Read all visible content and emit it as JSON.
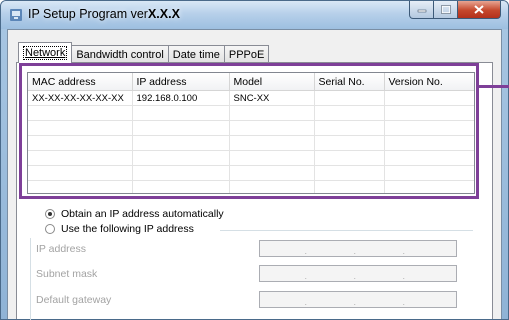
{
  "window": {
    "title_prefix": "IP Setup Program ver",
    "title_version": "X.X.X"
  },
  "tabs": [
    {
      "label": "Network",
      "active": true
    },
    {
      "label": "Bandwidth control",
      "active": false
    },
    {
      "label": "Date time",
      "active": false
    },
    {
      "label": "PPPoE",
      "active": false
    }
  ],
  "device_table": {
    "columns": [
      "MAC address",
      "IP address",
      "Model",
      "Serial No.",
      "Version No."
    ],
    "rows": [
      [
        "XX-XX-XX-XX-XX-XX",
        "192.168.0.100",
        "SNC-XX",
        "",
        ""
      ]
    ],
    "empty_rows": 9
  },
  "ip_settings": {
    "auto_label": "Obtain an IP address automatically",
    "manual_label": "Use the following IP address",
    "selected": "auto",
    "fields": [
      {
        "label": "IP address",
        "value": ""
      },
      {
        "label": "Subnet mask",
        "value": ""
      },
      {
        "label": "Default gateway",
        "value": ""
      }
    ]
  },
  "colors": {
    "highlight": "#7e3f98"
  }
}
